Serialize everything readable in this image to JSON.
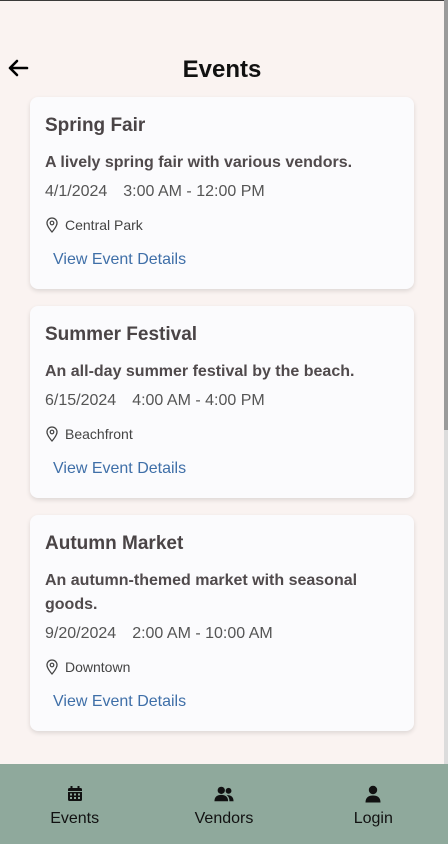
{
  "header": {
    "title": "Events",
    "back_icon": "arrow-left-icon"
  },
  "events": [
    {
      "title": "Spring Fair",
      "description": "A lively spring fair with various vendors.",
      "date": "4/1/2024",
      "time": "3:00 AM - 12:00 PM",
      "location": "Central Park",
      "link_label": "View Event Details"
    },
    {
      "title": "Summer Festival",
      "description": "An all-day summer festival by the beach.",
      "date": "6/15/2024",
      "time": "4:00 AM - 4:00 PM",
      "location": "Beachfront",
      "link_label": "View Event Details"
    },
    {
      "title": "Autumn Market",
      "description": "An autumn-themed market with seasonal goods.",
      "date": "9/20/2024",
      "time": "2:00 AM - 10:00 AM",
      "location": "Downtown",
      "link_label": "View Event Details"
    }
  ],
  "nav": {
    "items": [
      {
        "label": "Events",
        "icon": "calendar-icon"
      },
      {
        "label": "Vendors",
        "icon": "users-icon"
      },
      {
        "label": "Login",
        "icon": "user-icon"
      }
    ]
  },
  "colors": {
    "background": "#faf3f1",
    "card": "#fbfbfd",
    "link": "#3f6fa8",
    "nav_bar": "#8fa99c"
  }
}
